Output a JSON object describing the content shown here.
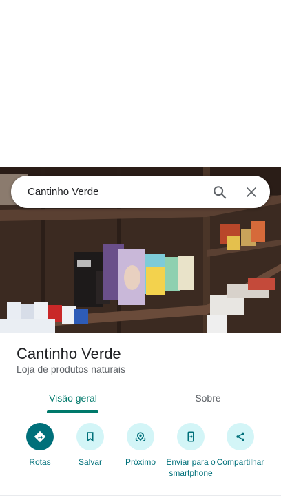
{
  "search": {
    "query": "Cantinho Verde",
    "search_icon": "search-icon",
    "close_icon": "close-icon"
  },
  "place": {
    "name": "Cantinho Verde",
    "category": "Loja de produtos naturais",
    "photo": "store-shelves-photo"
  },
  "tabs": [
    {
      "label": "Visão geral",
      "selected": true
    },
    {
      "label": "Sobre",
      "selected": false
    }
  ],
  "actions": [
    {
      "label": "Rotas",
      "icon": "directions-icon"
    },
    {
      "label": "Salvar",
      "icon": "bookmark-icon"
    },
    {
      "label": "Próximo",
      "icon": "nearby-icon"
    },
    {
      "label": "Enviar para o smartphone",
      "icon": "send-to-phone-icon"
    },
    {
      "label": "Compartilhar",
      "icon": "share-icon"
    }
  ],
  "colors": {
    "accent": "#00796b",
    "action_bg": "#d3f5f7",
    "primary_action": "#00707a"
  }
}
